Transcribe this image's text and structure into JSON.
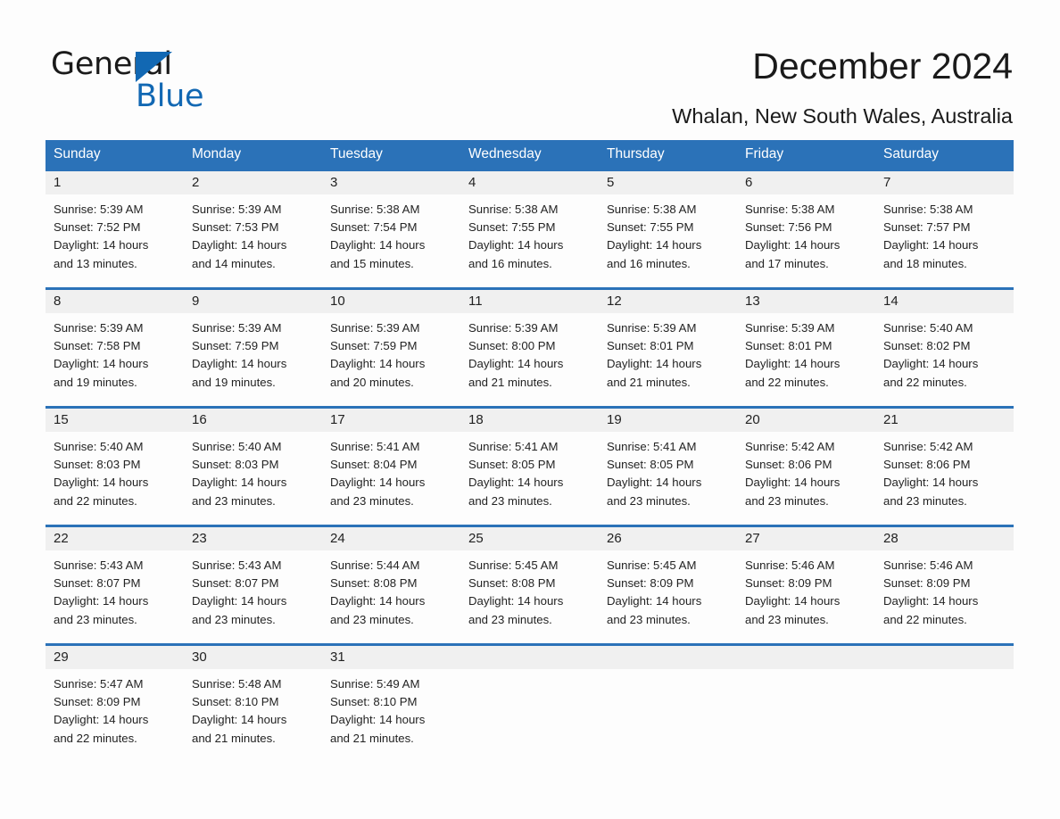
{
  "brand": {
    "name_part1": "General",
    "name_part2": "Blue",
    "accent_color": "#1268b3",
    "triangle_icon": "triangle-icon"
  },
  "header": {
    "title": "December 2024",
    "subtitle": "Whalan, New South Wales, Australia"
  },
  "calendar": {
    "header_color": "#2b72b8",
    "daynum_band_color": "#f0f0f0",
    "weekday_headers": [
      "Sunday",
      "Monday",
      "Tuesday",
      "Wednesday",
      "Thursday",
      "Friday",
      "Saturday"
    ],
    "weeks": [
      {
        "days": [
          {
            "date": "1",
            "sunrise": "Sunrise: 5:39 AM",
            "sunset": "Sunset: 7:52 PM",
            "daylight_line1": "Daylight: 14 hours",
            "daylight_line2": "and 13 minutes."
          },
          {
            "date": "2",
            "sunrise": "Sunrise: 5:39 AM",
            "sunset": "Sunset: 7:53 PM",
            "daylight_line1": "Daylight: 14 hours",
            "daylight_line2": "and 14 minutes."
          },
          {
            "date": "3",
            "sunrise": "Sunrise: 5:38 AM",
            "sunset": "Sunset: 7:54 PM",
            "daylight_line1": "Daylight: 14 hours",
            "daylight_line2": "and 15 minutes."
          },
          {
            "date": "4",
            "sunrise": "Sunrise: 5:38 AM",
            "sunset": "Sunset: 7:55 PM",
            "daylight_line1": "Daylight: 14 hours",
            "daylight_line2": "and 16 minutes."
          },
          {
            "date": "5",
            "sunrise": "Sunrise: 5:38 AM",
            "sunset": "Sunset: 7:55 PM",
            "daylight_line1": "Daylight: 14 hours",
            "daylight_line2": "and 16 minutes."
          },
          {
            "date": "6",
            "sunrise": "Sunrise: 5:38 AM",
            "sunset": "Sunset: 7:56 PM",
            "daylight_line1": "Daylight: 14 hours",
            "daylight_line2": "and 17 minutes."
          },
          {
            "date": "7",
            "sunrise": "Sunrise: 5:38 AM",
            "sunset": "Sunset: 7:57 PM",
            "daylight_line1": "Daylight: 14 hours",
            "daylight_line2": "and 18 minutes."
          }
        ]
      },
      {
        "days": [
          {
            "date": "8",
            "sunrise": "Sunrise: 5:39 AM",
            "sunset": "Sunset: 7:58 PM",
            "daylight_line1": "Daylight: 14 hours",
            "daylight_line2": "and 19 minutes."
          },
          {
            "date": "9",
            "sunrise": "Sunrise: 5:39 AM",
            "sunset": "Sunset: 7:59 PM",
            "daylight_line1": "Daylight: 14 hours",
            "daylight_line2": "and 19 minutes."
          },
          {
            "date": "10",
            "sunrise": "Sunrise: 5:39 AM",
            "sunset": "Sunset: 7:59 PM",
            "daylight_line1": "Daylight: 14 hours",
            "daylight_line2": "and 20 minutes."
          },
          {
            "date": "11",
            "sunrise": "Sunrise: 5:39 AM",
            "sunset": "Sunset: 8:00 PM",
            "daylight_line1": "Daylight: 14 hours",
            "daylight_line2": "and 21 minutes."
          },
          {
            "date": "12",
            "sunrise": "Sunrise: 5:39 AM",
            "sunset": "Sunset: 8:01 PM",
            "daylight_line1": "Daylight: 14 hours",
            "daylight_line2": "and 21 minutes."
          },
          {
            "date": "13",
            "sunrise": "Sunrise: 5:39 AM",
            "sunset": "Sunset: 8:01 PM",
            "daylight_line1": "Daylight: 14 hours",
            "daylight_line2": "and 22 minutes."
          },
          {
            "date": "14",
            "sunrise": "Sunrise: 5:40 AM",
            "sunset": "Sunset: 8:02 PM",
            "daylight_line1": "Daylight: 14 hours",
            "daylight_line2": "and 22 minutes."
          }
        ]
      },
      {
        "days": [
          {
            "date": "15",
            "sunrise": "Sunrise: 5:40 AM",
            "sunset": "Sunset: 8:03 PM",
            "daylight_line1": "Daylight: 14 hours",
            "daylight_line2": "and 22 minutes."
          },
          {
            "date": "16",
            "sunrise": "Sunrise: 5:40 AM",
            "sunset": "Sunset: 8:03 PM",
            "daylight_line1": "Daylight: 14 hours",
            "daylight_line2": "and 23 minutes."
          },
          {
            "date": "17",
            "sunrise": "Sunrise: 5:41 AM",
            "sunset": "Sunset: 8:04 PM",
            "daylight_line1": "Daylight: 14 hours",
            "daylight_line2": "and 23 minutes."
          },
          {
            "date": "18",
            "sunrise": "Sunrise: 5:41 AM",
            "sunset": "Sunset: 8:05 PM",
            "daylight_line1": "Daylight: 14 hours",
            "daylight_line2": "and 23 minutes."
          },
          {
            "date": "19",
            "sunrise": "Sunrise: 5:41 AM",
            "sunset": "Sunset: 8:05 PM",
            "daylight_line1": "Daylight: 14 hours",
            "daylight_line2": "and 23 minutes."
          },
          {
            "date": "20",
            "sunrise": "Sunrise: 5:42 AM",
            "sunset": "Sunset: 8:06 PM",
            "daylight_line1": "Daylight: 14 hours",
            "daylight_line2": "and 23 minutes."
          },
          {
            "date": "21",
            "sunrise": "Sunrise: 5:42 AM",
            "sunset": "Sunset: 8:06 PM",
            "daylight_line1": "Daylight: 14 hours",
            "daylight_line2": "and 23 minutes."
          }
        ]
      },
      {
        "days": [
          {
            "date": "22",
            "sunrise": "Sunrise: 5:43 AM",
            "sunset": "Sunset: 8:07 PM",
            "daylight_line1": "Daylight: 14 hours",
            "daylight_line2": "and 23 minutes."
          },
          {
            "date": "23",
            "sunrise": "Sunrise: 5:43 AM",
            "sunset": "Sunset: 8:07 PM",
            "daylight_line1": "Daylight: 14 hours",
            "daylight_line2": "and 23 minutes."
          },
          {
            "date": "24",
            "sunrise": "Sunrise: 5:44 AM",
            "sunset": "Sunset: 8:08 PM",
            "daylight_line1": "Daylight: 14 hours",
            "daylight_line2": "and 23 minutes."
          },
          {
            "date": "25",
            "sunrise": "Sunrise: 5:45 AM",
            "sunset": "Sunset: 8:08 PM",
            "daylight_line1": "Daylight: 14 hours",
            "daylight_line2": "and 23 minutes."
          },
          {
            "date": "26",
            "sunrise": "Sunrise: 5:45 AM",
            "sunset": "Sunset: 8:09 PM",
            "daylight_line1": "Daylight: 14 hours",
            "daylight_line2": "and 23 minutes."
          },
          {
            "date": "27",
            "sunrise": "Sunrise: 5:46 AM",
            "sunset": "Sunset: 8:09 PM",
            "daylight_line1": "Daylight: 14 hours",
            "daylight_line2": "and 23 minutes."
          },
          {
            "date": "28",
            "sunrise": "Sunrise: 5:46 AM",
            "sunset": "Sunset: 8:09 PM",
            "daylight_line1": "Daylight: 14 hours",
            "daylight_line2": "and 22 minutes."
          }
        ]
      },
      {
        "days": [
          {
            "date": "29",
            "sunrise": "Sunrise: 5:47 AM",
            "sunset": "Sunset: 8:09 PM",
            "daylight_line1": "Daylight: 14 hours",
            "daylight_line2": "and 22 minutes."
          },
          {
            "date": "30",
            "sunrise": "Sunrise: 5:48 AM",
            "sunset": "Sunset: 8:10 PM",
            "daylight_line1": "Daylight: 14 hours",
            "daylight_line2": "and 21 minutes."
          },
          {
            "date": "31",
            "sunrise": "Sunrise: 5:49 AM",
            "sunset": "Sunset: 8:10 PM",
            "daylight_line1": "Daylight: 14 hours",
            "daylight_line2": "and 21 minutes."
          },
          {
            "date": "",
            "sunrise": "",
            "sunset": "",
            "daylight_line1": "",
            "daylight_line2": ""
          },
          {
            "date": "",
            "sunrise": "",
            "sunset": "",
            "daylight_line1": "",
            "daylight_line2": ""
          },
          {
            "date": "",
            "sunrise": "",
            "sunset": "",
            "daylight_line1": "",
            "daylight_line2": ""
          },
          {
            "date": "",
            "sunrise": "",
            "sunset": "",
            "daylight_line1": "",
            "daylight_line2": ""
          }
        ]
      }
    ]
  }
}
